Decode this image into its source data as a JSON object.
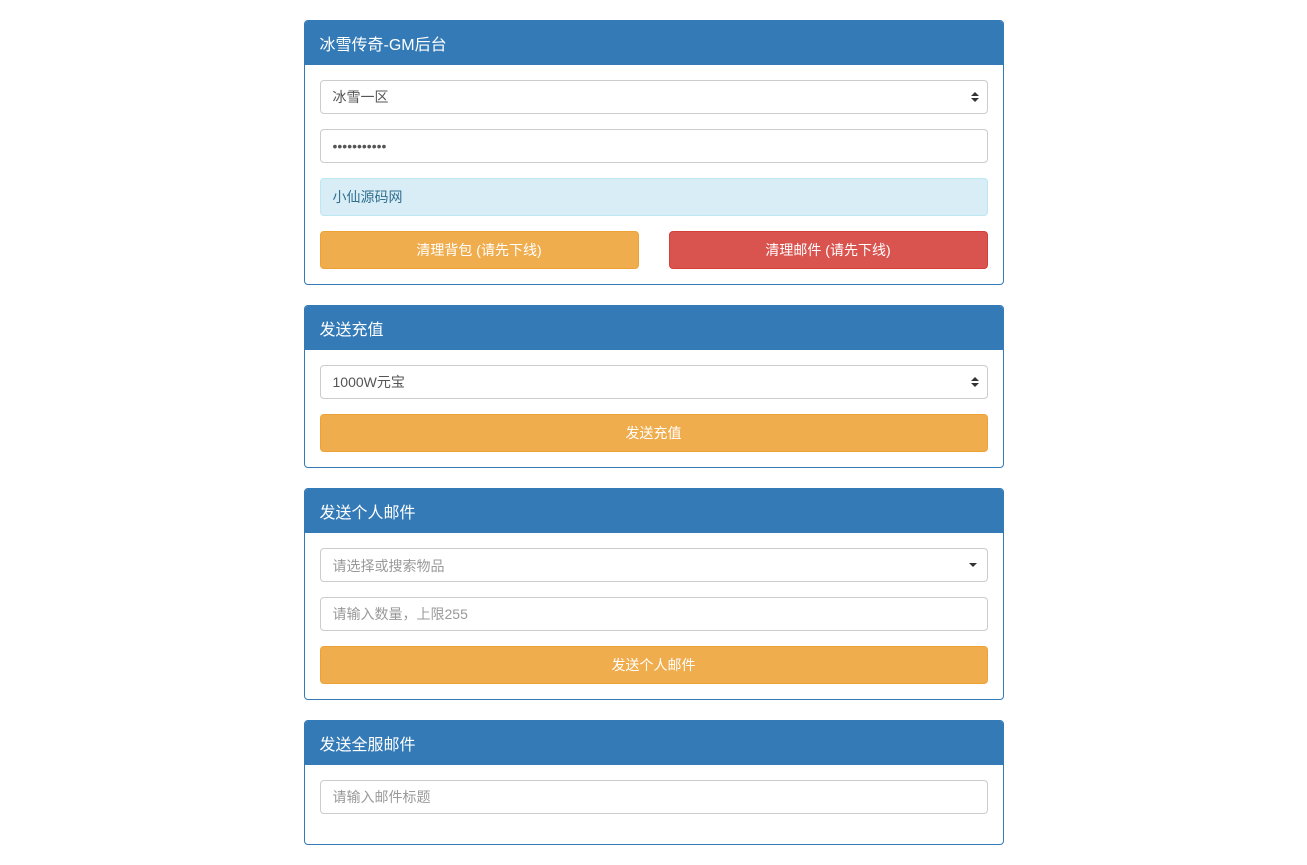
{
  "panel1": {
    "title": "冰雪传奇-GM后台",
    "server_select": {
      "selected": "冰雪一区"
    },
    "password_value": "•••••••••••",
    "readonly_text": "小仙源码网",
    "btn_clear_bag": "清理背包 (请先下线)",
    "btn_clear_mail": "清理邮件 (请先下线)"
  },
  "panel2": {
    "title": "发送充值",
    "recharge_select": {
      "selected": "1000W元宝"
    },
    "btn_send": "发送充值"
  },
  "panel3": {
    "title": "发送个人邮件",
    "item_placeholder": "请选择或搜索物品",
    "qty_placeholder": "请输入数量，上限255",
    "btn_send": "发送个人邮件"
  },
  "panel4": {
    "title": "发送全服邮件",
    "subject_placeholder": "请输入邮件标题"
  }
}
